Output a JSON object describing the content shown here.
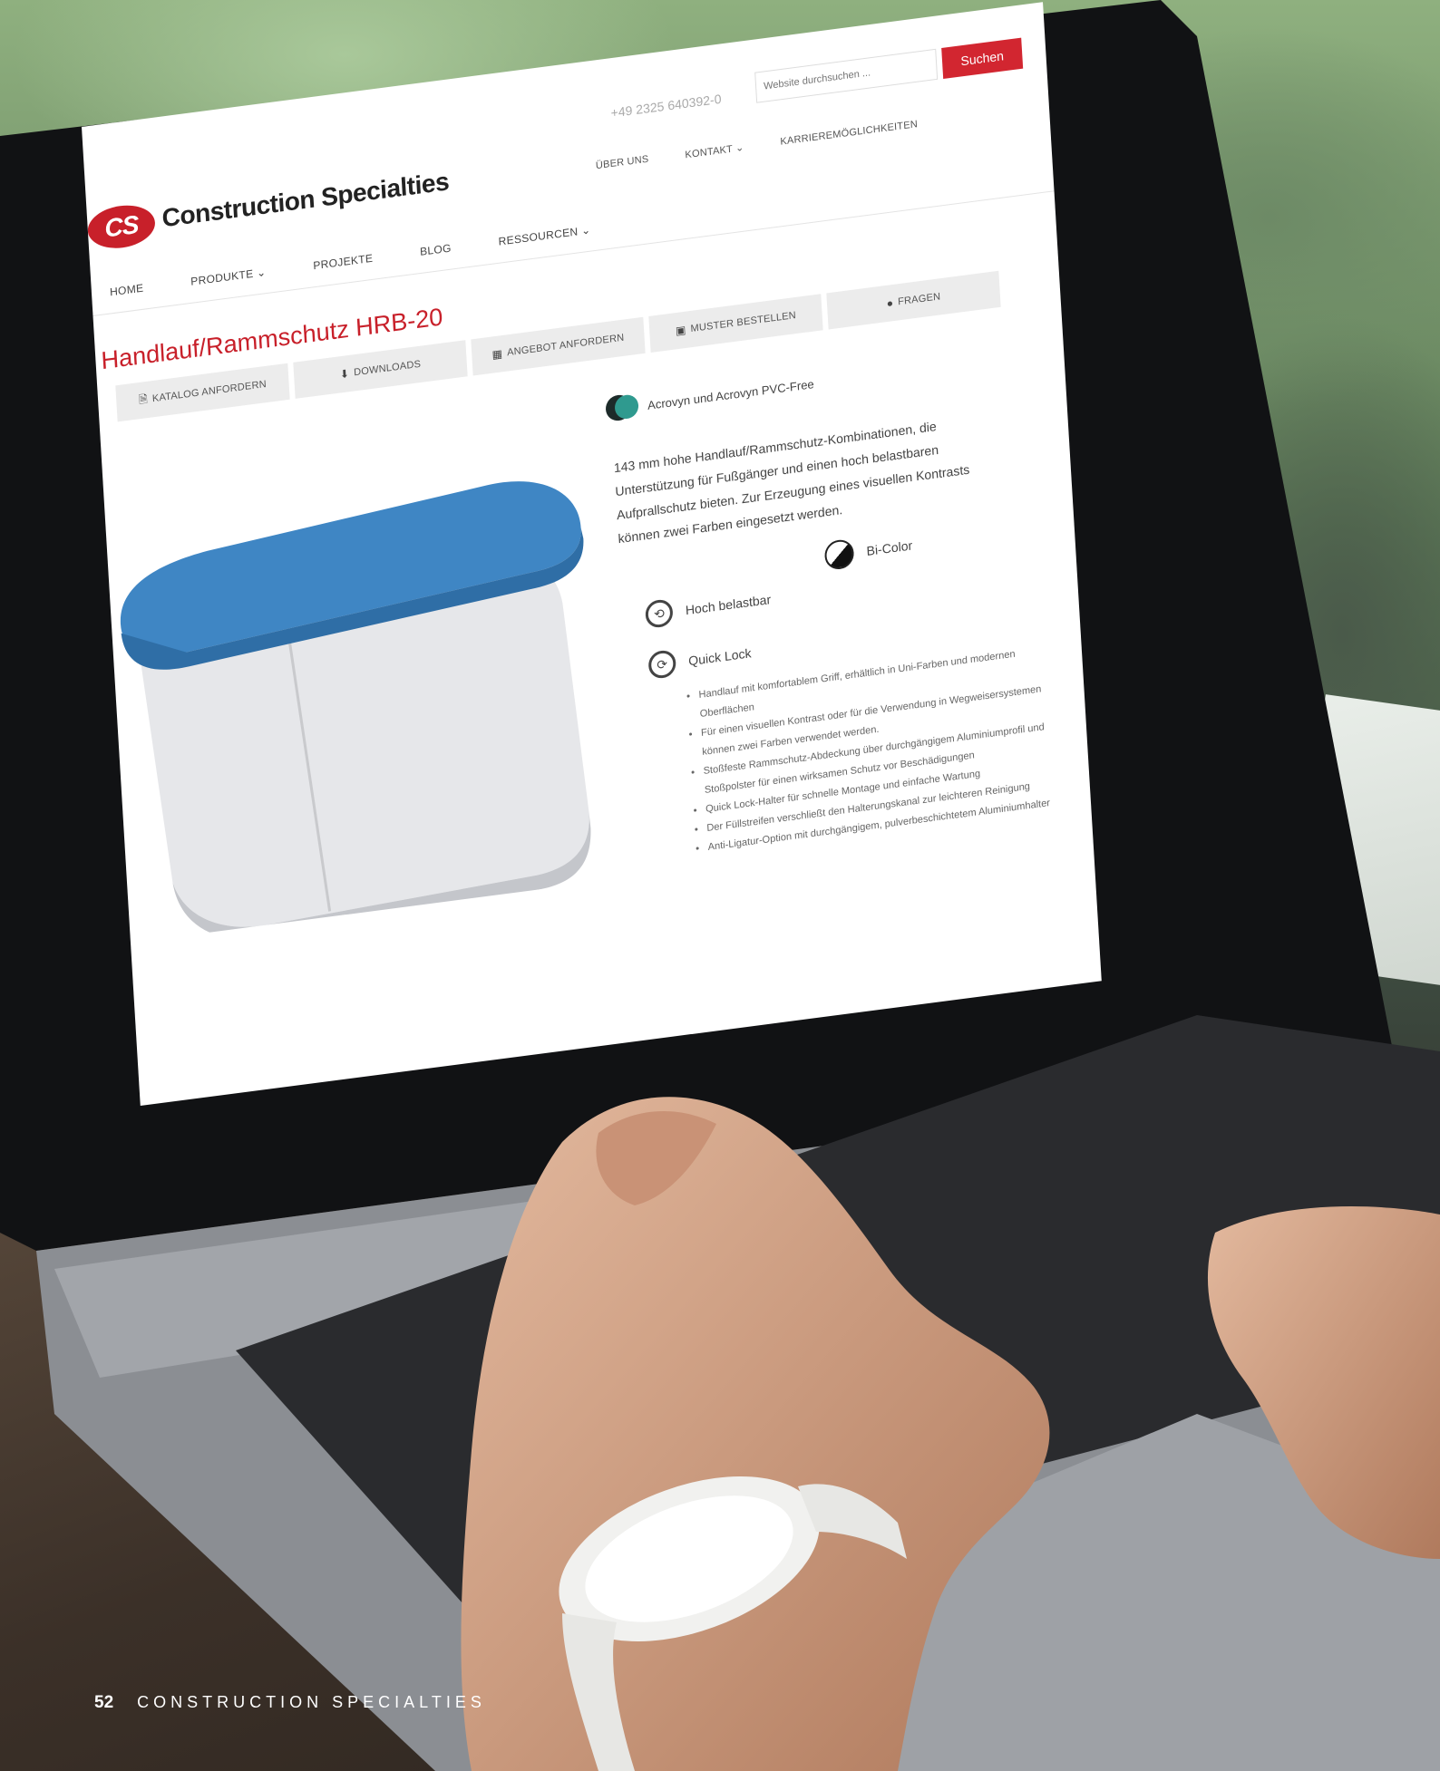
{
  "site": {
    "logo_badge": "CS",
    "logo_text": "Construction Specialties",
    "phone": "+49 2325 640392-0",
    "search": {
      "placeholder": "Website durchsuchen ...",
      "button_label": "Suchen"
    },
    "top_nav": [
      "ÜBER UNS",
      "KONTAKT",
      "KARRIEREMÖGLICHKEITEN"
    ],
    "main_nav": [
      "HOME",
      "PRODUKTE",
      "PROJEKTE",
      "BLOG",
      "RESSOURCEN"
    ]
  },
  "product": {
    "title": "Handlauf/Rammschutz HRB-20",
    "actions": [
      {
        "label": "KATALOG ANFORDERN",
        "icon": "document-icon"
      },
      {
        "label": "DOWNLOADS",
        "icon": "download-icon"
      },
      {
        "label": "ANGEBOT ANFORDERN",
        "icon": "calculator-icon"
      },
      {
        "label": "MUSTER BESTELLEN",
        "icon": "box-icon"
      },
      {
        "label": "FRAGEN",
        "icon": "user-icon"
      }
    ],
    "material": "Acrovyn und Acrovyn PVC-Free",
    "description": "143 mm hohe Handlauf/Rammschutz-Kombinationen, die Unterstützung für Fußgänger und einen hoch belastbaren Aufprallschutz bieten. Zur Erzeugung eines visuellen Kontrasts können zwei Farben eingesetzt werden.",
    "features": [
      "Hoch belastbar",
      "Quick Lock",
      "Bi-Color"
    ],
    "bullets": [
      "Handlauf mit komfortablem Griff, erhältlich in Uni-Farben und modernen Oberflächen",
      "Für einen visuellen Kontrast oder für die Verwendung in Wegweisersystemen können zwei Farben verwendet werden.",
      "Stoßfeste Rammschutz-Abdeckung über durchgängigem Aluminiumprofil und Stoßpolster für einen wirksamen Schutz vor Beschädigungen",
      "Quick Lock-Halter für schnelle Montage und einfache Wartung",
      "Der Füllstreifen verschließt den Halterungskanal zur leichteren Reinigung",
      "Anti-Ligatur-Option mit durchgängigem, pulverbeschichtetem Aluminiumhalter"
    ],
    "colors": {
      "handrail_top": "#3f86c4",
      "body": "#e6e7ea",
      "accent": "#d22630"
    }
  },
  "footer": {
    "page_number": "52",
    "brand": "CONSTRUCTION SPECIALTIES"
  }
}
